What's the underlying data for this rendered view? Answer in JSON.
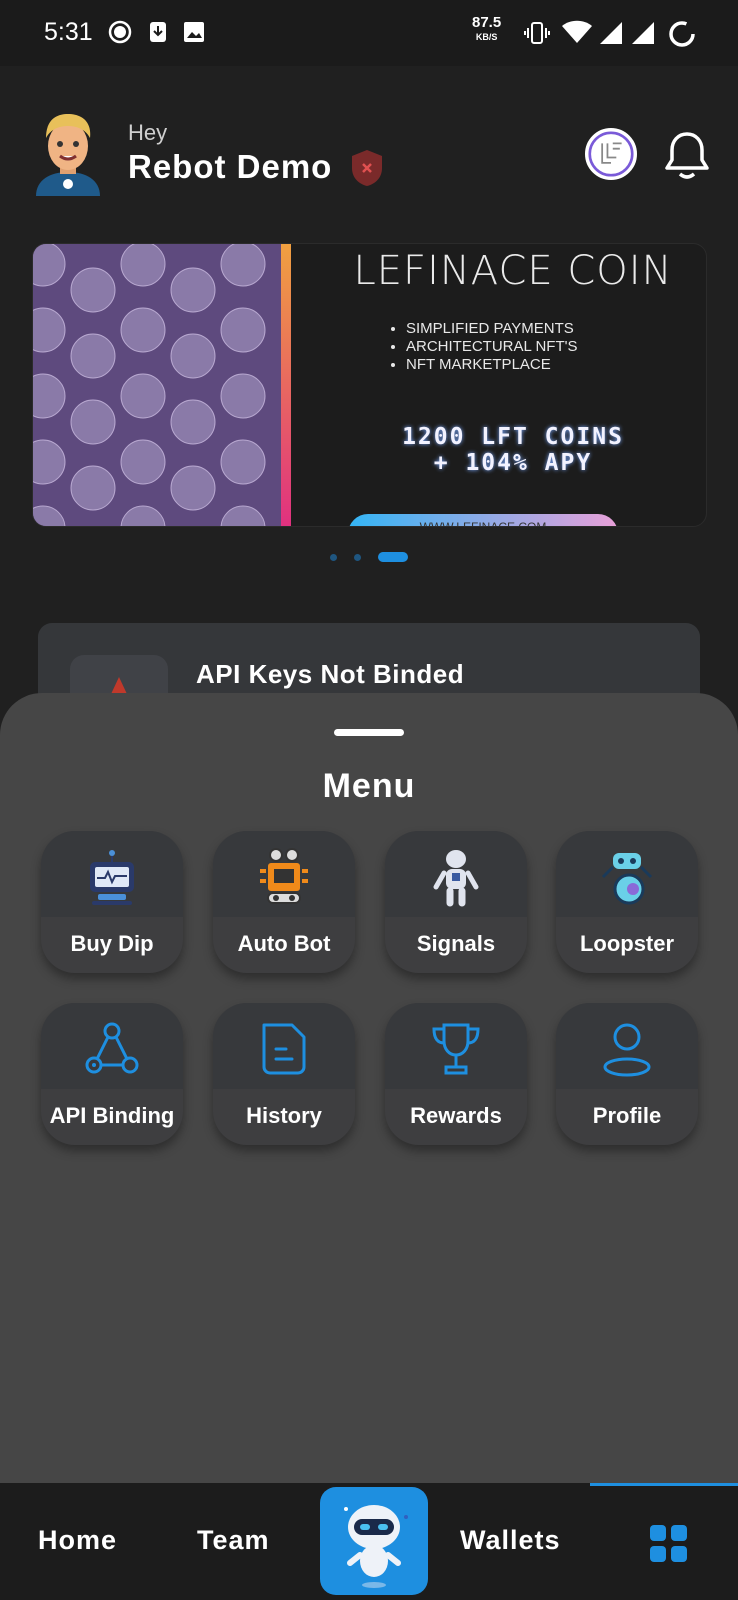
{
  "status_bar": {
    "time": "5:31",
    "net_speed": "87.5",
    "net_unit": "KB/S"
  },
  "header": {
    "greeting": "Hey",
    "user_name": "Rebot Demo"
  },
  "banner": {
    "title": "LEFINACE COIN",
    "features": [
      "SIMPLIFIED PAYMENTS",
      "ARCHITECTURAL NFT'S",
      "NFT MARKETPLACE"
    ],
    "offer_line1": "1200 LFT COINS",
    "offer_line2": "+ 104% APY",
    "url": "WWW.LEFINACE.COM",
    "slides": 3,
    "active_slide": 3
  },
  "api_card": {
    "title": "API Keys Not Binded"
  },
  "menu": {
    "title": "Menu",
    "items": [
      {
        "label": "Buy Dip",
        "icon": "monitor-robot-icon"
      },
      {
        "label": "Auto Bot",
        "icon": "orange-robot-icon"
      },
      {
        "label": "Signals",
        "icon": "humanoid-robot-icon"
      },
      {
        "label": "Loopster",
        "icon": "wheel-robot-icon"
      },
      {
        "label": "API Binding",
        "icon": "share-nodes-icon"
      },
      {
        "label": "History",
        "icon": "document-icon"
      },
      {
        "label": "Rewards",
        "icon": "trophy-icon"
      },
      {
        "label": "Profile",
        "icon": "user-icon"
      }
    ]
  },
  "bottom_nav": {
    "home": "Home",
    "team": "Team",
    "wallets": "Wallets",
    "accent": "#1e8fe0"
  }
}
